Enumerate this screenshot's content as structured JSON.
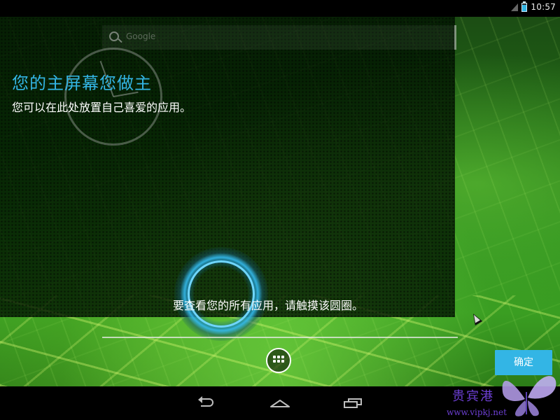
{
  "status_bar": {
    "time": "10:57",
    "signal_icon": "signal-empty-icon",
    "battery_icon": "battery-charging-icon"
  },
  "search_widget": {
    "placeholder": "Google"
  },
  "cling": {
    "title": "您的主屏幕您做主",
    "subtitle": "您可以在此处放置自己喜爱的应用。",
    "all_apps_hint": "要查看您的所有应用，请触摸该圆圈。",
    "confirm_label": "确定",
    "accent_color": "#33b5e5"
  },
  "hotseat": {
    "all_apps_icon": "apps-grid-icon"
  },
  "nav_bar": {
    "back_icon": "back-icon",
    "home_icon": "home-icon",
    "recents_icon": "recents-icon"
  },
  "watermark": {
    "title": "贵宾港",
    "url": "www.vipkj.net"
  }
}
